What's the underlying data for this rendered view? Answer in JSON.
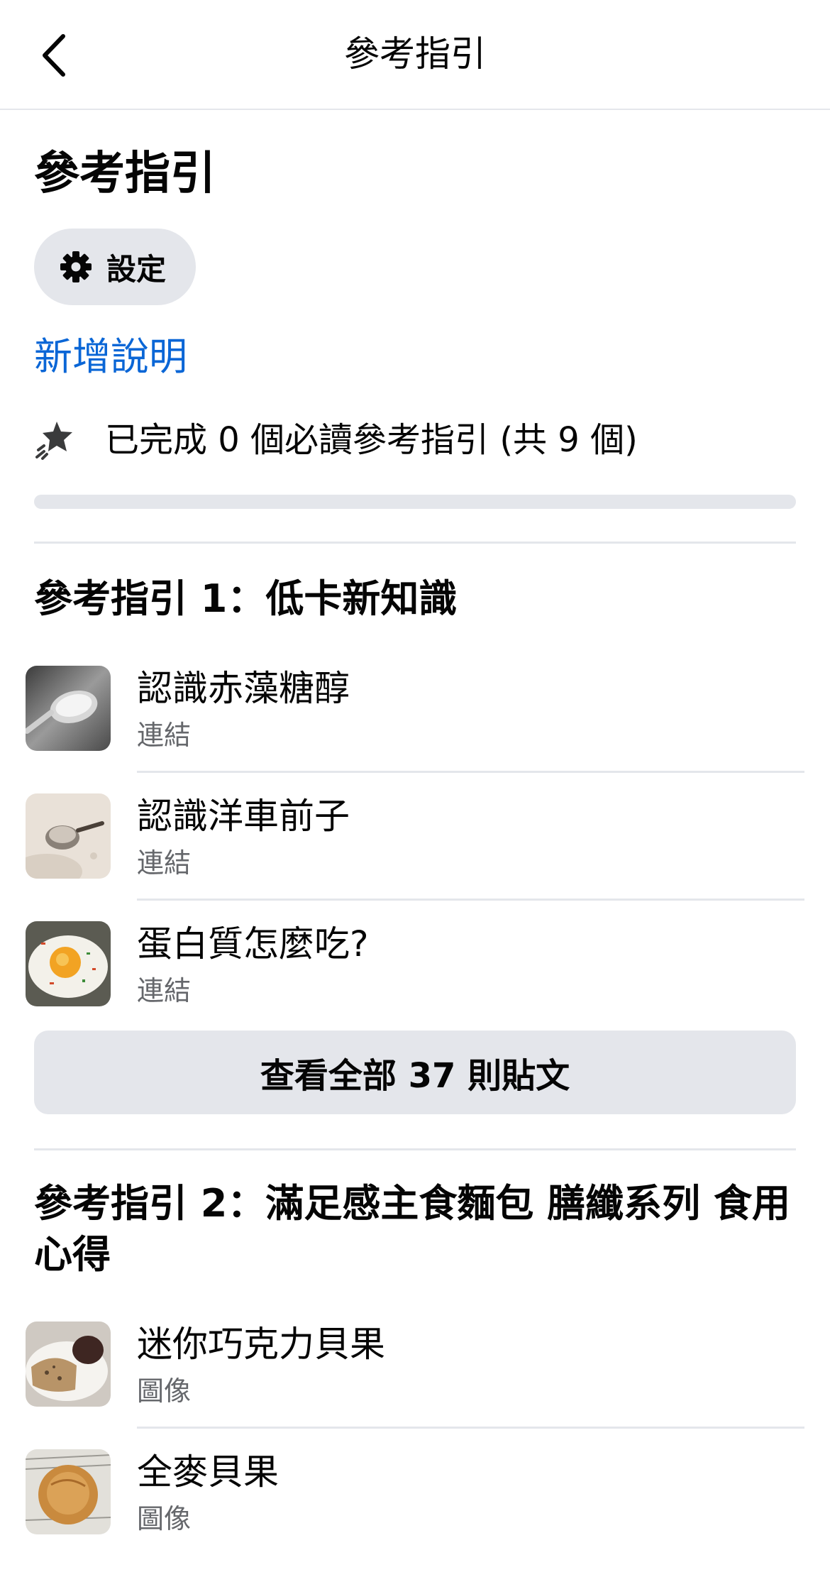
{
  "header": {
    "title": "參考指引"
  },
  "page": {
    "title": "參考指引",
    "settings_label": "設定",
    "add_description": "新增說明",
    "progress_text": "已完成 0 個必讀參考指引 (共 9 個)",
    "progress_value": 0
  },
  "sections": [
    {
      "title": "參考指引 1：低卡新知識",
      "items": [
        {
          "title": "認識赤藻糖醇",
          "type": "連結",
          "thumb": "sugar-spoon-image"
        },
        {
          "title": "認識洋車前子",
          "type": "連結",
          "thumb": "psyllium-powder-image"
        },
        {
          "title": "蛋白質怎麼吃?",
          "type": "連結",
          "thumb": "fried-egg-image"
        }
      ],
      "view_all_label": "查看全部 37 則貼文"
    },
    {
      "title": "參考指引 2：滿足感主食麵包 膳纖系列 食用心得",
      "items": [
        {
          "title": "迷你巧克力貝果",
          "type": "圖像",
          "thumb": "bagel-plate-image"
        },
        {
          "title": "全麥貝果",
          "type": "圖像",
          "thumb": "whole-wheat-bagel-image"
        }
      ]
    }
  ],
  "colors": {
    "link": "#0a66d6",
    "secondary_text": "#65676b",
    "divider": "#e4e6eb",
    "button_bg": "#e4e6eb"
  }
}
